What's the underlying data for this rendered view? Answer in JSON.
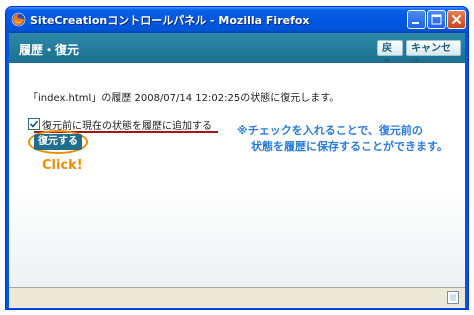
{
  "window": {
    "title": "SiteCreationコントロールパネル - Mozilla Firefox"
  },
  "header": {
    "title": "履歴・復元",
    "back_label": "戻る",
    "cancel_label": "キャンセル"
  },
  "main": {
    "message": "「index.html」の履歴 2008/07/14 12:02:25の状態に復元します。",
    "checkbox_label": "復元前に現在の状態を履歴に追加する",
    "checkbox_checked": true,
    "restore_label": "復元する",
    "click_label": "Click!",
    "note_line1": "※チェックを入れることで、復元前の",
    "note_line2": "状態を履歴に保存することができます。"
  },
  "colors": {
    "header_bg": "#1d6f8f",
    "accent_orange": "#f08c00",
    "note_blue": "#2a7be0",
    "underline_red": "#a01818"
  },
  "icons": {
    "app": "firefox-icon",
    "minimize": "minimize-icon",
    "maximize": "maximize-icon",
    "close": "close-icon",
    "status": "page-icon"
  }
}
